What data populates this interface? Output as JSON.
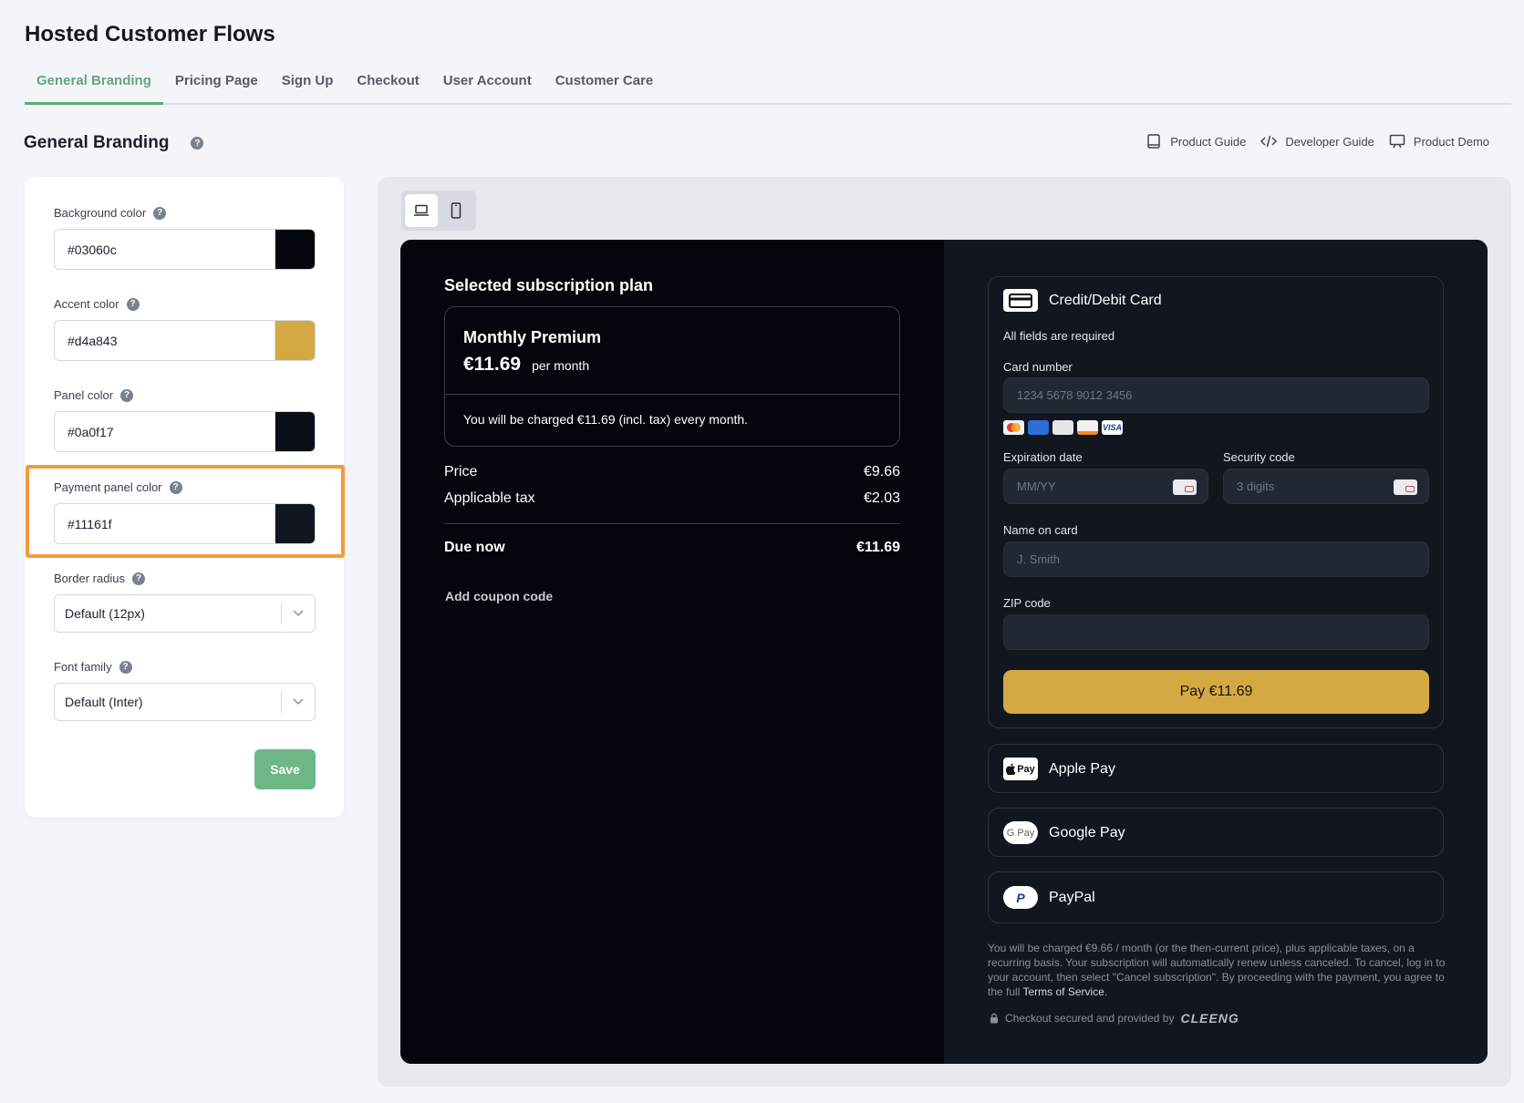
{
  "page": {
    "title": "Hosted Customer Flows",
    "tabs": [
      {
        "label": "General Branding"
      },
      {
        "label": "Pricing Page"
      },
      {
        "label": "Sign Up"
      },
      {
        "label": "Checkout"
      },
      {
        "label": "User Account"
      },
      {
        "label": "Customer Care"
      }
    ],
    "active_tab": "General Branding"
  },
  "section": {
    "title": "General Branding",
    "help": "?"
  },
  "guides": {
    "product_guide": "Product Guide",
    "developer_guide": "Developer Guide",
    "product_demo": "Product Demo"
  },
  "settings": {
    "background_color": {
      "label": "Background color",
      "value": "#03060c"
    },
    "accent_color": {
      "label": "Accent color",
      "value": "#d4a843"
    },
    "panel_color": {
      "label": "Panel color",
      "value": "#0a0f17"
    },
    "payment_panel_color": {
      "label": "Payment panel color",
      "value": "#11161f"
    },
    "border_radius": {
      "label": "Border radius",
      "value": "Default (12px)"
    },
    "font_family": {
      "label": "Font family",
      "value": "Default (Inter)"
    },
    "save_label": "Save"
  },
  "colors": {
    "tab_active": "#5fa87a",
    "save_button": "#6db685",
    "highlight": "#f39a3c"
  },
  "checkout": {
    "selected_title": "Selected subscription plan",
    "plan": {
      "name": "Monthly Premium",
      "price": "€11.69",
      "period": "per month",
      "note": "You will be charged €11.69 (incl. tax) every month."
    },
    "summary": {
      "price_label": "Price",
      "price_value": "€9.66",
      "tax_label": "Applicable tax",
      "tax_value": "€2.03",
      "due_label": "Due now",
      "due_value": "€11.69"
    },
    "coupon": "Add coupon code",
    "card": {
      "title": "Credit/Debit Card",
      "required": "All fields are required",
      "card_number_label": "Card number",
      "card_number_placeholder": "1234 5678 9012 3456",
      "expiration_label": "Expiration date",
      "expiration_placeholder": "MM/YY",
      "security_label": "Security code",
      "security_placeholder": "3 digits",
      "name_label": "Name on card",
      "name_placeholder": "J. Smith",
      "zip_label": "ZIP code",
      "zip_placeholder": "",
      "pay_label": "Pay €11.69"
    },
    "methods": {
      "apple": {
        "label": "Apple Pay",
        "badge": "Pay"
      },
      "google": {
        "label": "Google Pay",
        "badge": "G Pay"
      },
      "paypal": {
        "label": "PayPal",
        "badge": "P"
      }
    },
    "disclaimer": "You will be charged €9.66 / month (or the then-current price), plus applicable taxes, on a recurring basis. Your subscription will automatically renew unless canceled. To cancel, log in to your account, then select \"Cancel subscription\". By proceeding with the payment, you agree to the full ",
    "terms": "Terms of Service",
    "terms_end": ".",
    "secured": "Checkout secured and provided by",
    "provider_logo": "CLEENG"
  }
}
